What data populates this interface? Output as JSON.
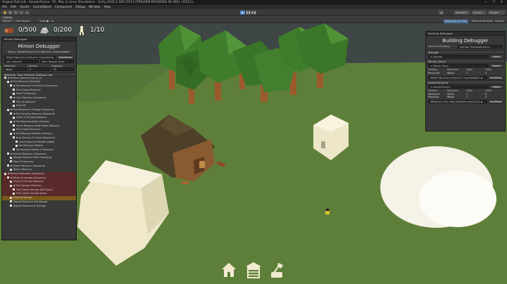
{
  "window": {
    "title": "OrganicTrail.init - SampleScene - PC, Mac & Linux Standalone - Unity 2020.3.18f1 DX11 [PREVIEW PACKAGES IN USE] <DX11>",
    "controls": "— ❐ ✕"
  },
  "menu": [
    "File",
    "Edit",
    "Assets",
    "GameObject",
    "Component",
    "Debug",
    "Window",
    "Help"
  ],
  "toolbar": {
    "account": "Account",
    "layers": "Layers",
    "layout": "Layout",
    "play": "▶",
    "pause": "❚❚",
    "step": "▶❚"
  },
  "game_view": {
    "tab": "Game",
    "display": "Display 1",
    "aspect": "Free Aspect",
    "scale_label": "Scale",
    "scale_value": "1x",
    "maximize": "Maximize On Play",
    "mute": "Mute Audio",
    "stats": "Stats",
    "gizmos": "Gizmos"
  },
  "hud": {
    "wood": "0/500",
    "stone": "0/200",
    "population": "1/10"
  },
  "minion_debugger": {
    "tab": "Minion Debugger",
    "title": "Minion Debugger",
    "minion_label": "Minion: 6906576b-b7a5-47d6-a97e-7ebe50e8d6f7",
    "minion_field": "6906576b-b7a5-47d6-a97e-7ebe50e8 ◉",
    "find_button": "Find Minion",
    "job_label": "Job: Gatherer",
    "role_label": "Role: Wander Stock",
    "stats": [
      {
        "label": "Resource",
        "value": "Wood"
      },
      {
        "label": "Carried",
        "value": "0"
      },
      {
        "label": "Capacity",
        "value": "10"
      }
    ],
    "behavior_header": "Behavior Tree: Perform Gatherer Job",
    "tree": [
      {
        "label": "▼ Perform Gatherer Job (GL_0)",
        "indent": 0,
        "state": ""
      },
      {
        "label": "▼ Find Resource (Selector)",
        "indent": 1,
        "state": ""
      },
      {
        "label": "▼ Find Resource on Ground (Sequence)",
        "indent": 2,
        "state": ""
      },
      {
        "label": "Find Closest Resource",
        "indent": 3,
        "state": ""
      },
      {
        "label": "Move To Resource",
        "indent": 3,
        "state": ""
      },
      {
        "label": "▼ Carry Resource (Sequence)",
        "indent": 2,
        "state": ""
      },
      {
        "label": "Pick Up Resource",
        "indent": 3,
        "state": ""
      },
      {
        "label": "Drop Off",
        "indent": 3,
        "state": ""
      },
      {
        "label": "▼ Find Resource in Storage (Sequence)",
        "indent": 1,
        "state": ""
      },
      {
        "label": "▼ Find Carrying Resource (Sequence)",
        "indent": 2,
        "state": ""
      },
      {
        "label": "Check If Carrying Resource",
        "indent": 3,
        "state": ""
      },
      {
        "label": "▼ Find Resource Node (Selector)",
        "indent": 2,
        "state": ""
      },
      {
        "label": "Check Resource Node Target Resource",
        "indent": 3,
        "state": ""
      },
      {
        "label": "Find Closest Resource",
        "indent": 3,
        "state": ""
      },
      {
        "label": "▼ Find Resource Position (Selector)",
        "indent": 2,
        "state": ""
      },
      {
        "label": "▼ Go Directly If Visible (Sequence)",
        "indent": 3,
        "state": ""
      },
      {
        "label": "Check Resource Position Visible",
        "indent": 4,
        "state": ""
      },
      {
        "label": "Set Resource Position",
        "indent": 4,
        "state": ""
      },
      {
        "label": "Get Random Position In Resource",
        "indent": 3,
        "state": ""
      },
      {
        "label": "▼ Harvest Resource (Sequence)",
        "indent": 1,
        "state": ""
      },
      {
        "label": "Harvest Resource With Harvesting",
        "indent": 2,
        "state": ""
      },
      {
        "label": "Move To Resource",
        "indent": 2,
        "state": ""
      },
      {
        "label": "▼ Gather Resource (Sequence)",
        "indent": 1,
        "state": ""
      },
      {
        "label": "Return Resource",
        "indent": 2,
        "state": ""
      },
      {
        "label": "▼ Perform Deliveries (Sequence)",
        "indent": 0,
        "state": "hl"
      },
      {
        "label": "▼ Return to storage (Sequence)",
        "indent": 1,
        "state": "hl"
      },
      {
        "label": "Check If Carrying Resource",
        "indent": 2,
        "state": "hl"
      },
      {
        "label": "▼ Find Storage (Selector)",
        "indent": 2,
        "state": "hl"
      },
      {
        "label": "Find Closest Storage With Space",
        "indent": 3,
        "state": "hl"
      },
      {
        "label": "Find Closest Storage Space",
        "indent": 3,
        "state": "hl"
      },
      {
        "label": "Move To Storage",
        "indent": 2,
        "state": "sel"
      },
      {
        "label": "Deposit Resource Into Storage",
        "indent": 2,
        "state": ""
      },
      {
        "label": "Deposit Resource To Storage",
        "indent": 2,
        "state": ""
      }
    ]
  },
  "building_debugger": {
    "tab": "Building Debugger",
    "title": "Building Debugger",
    "selected_label": "Selected Building",
    "selected_value": "Storage (StorageBuilding)",
    "sections": [
      {
        "header": "Storage",
        "field": "◎ Storage",
        "button": "Select",
        "rows": []
      },
      {
        "header": "Minion_Stock",
        "field": "◎ Minion_Stock",
        "button": "Select",
        "rows": [
          {
            "position": "Backyard",
            "resource": "Wood",
            "open": "1",
            "filled": "0"
          }
        ],
        "guid": "6906576b-b7a5-47d6-a97e-7ebe50e8d6f7 ◉",
        "guid_button": "Find Minion"
      },
      {
        "header": "Sawmill(Clone)",
        "field": "◎ Sawmill(Clone)",
        "button": "Select",
        "rows": [
          {
            "position": "Backyard",
            "resource": "Stone",
            "open": "1",
            "filled": "0"
          },
          {
            "position": "Producer",
            "resource": "Wood",
            "open": "1",
            "filled": "0"
          }
        ],
        "guid": "96900bc4-c9d7-456a-9646-69cc4bc23a18 ◉",
        "guid_button": "Find Minion"
      }
    ],
    "columns": [
      "Position",
      "Resource",
      "Open",
      "Filled"
    ]
  },
  "colors": {
    "ground": "#5e7f39",
    "sky": "#3f4646",
    "panel_bg": "#383838",
    "highlight": "#5a2a2a",
    "selected": "#7a5a1a",
    "foliage": "#3f7d2c",
    "trunk": "#9c5a2c",
    "building": "#f0ead0"
  }
}
